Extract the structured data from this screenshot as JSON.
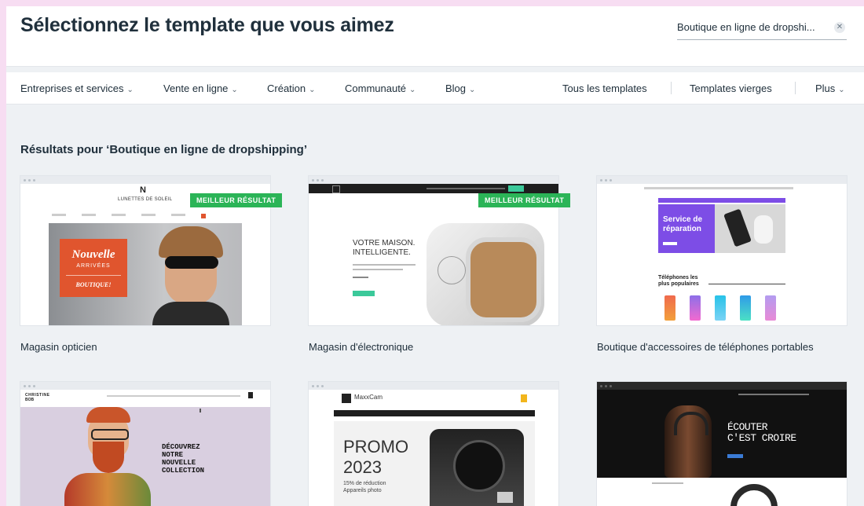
{
  "header": {
    "title": "Sélectionnez le template que vous aimez",
    "search_value": "Boutique en ligne de dropshi...",
    "clear_icon": "close-icon"
  },
  "nav": {
    "items": [
      {
        "label": "Entreprises et services",
        "dropdown": true
      },
      {
        "label": "Vente en ligne",
        "dropdown": true
      },
      {
        "label": "Création",
        "dropdown": true
      },
      {
        "label": "Communauté",
        "dropdown": true
      },
      {
        "label": "Blog",
        "dropdown": true
      }
    ],
    "right": [
      {
        "label": "Tous les templates"
      },
      {
        "label": "Templates vierges"
      },
      {
        "label": "Plus",
        "dropdown": true
      }
    ]
  },
  "results": {
    "heading": "Résultats pour ‘Boutique en ligne de dropshipping’",
    "badge_label": "MEILLEUR RÉSULTAT",
    "templates": [
      {
        "name": "Magasin opticien",
        "best": true,
        "preview": {
          "logo": "N",
          "brand": "LUNETTES DE SOLEIL",
          "promo_line1": "Nouvelle",
          "promo_line2": "ARRIVÉES",
          "promo_button": "BOUTIQUE!",
          "accent": "#e0552e"
        }
      },
      {
        "name": "Magasin d'électronique",
        "best": true,
        "preview": {
          "headline_line1": "VOTRE MAISON.",
          "headline_line2": "INTELLIGENTE.",
          "accent": "#3bc99a"
        }
      },
      {
        "name": "Boutique d'accessoires de téléphones portables",
        "best": false,
        "preview": {
          "banner_line1": "Service de",
          "banner_line2": "réparation",
          "section_line1": "Téléphones les",
          "section_line2": "plus populaires",
          "accent": "#7d4de6"
        }
      },
      {
        "name": "",
        "best": false,
        "preview": {
          "brand_line1": "CHRISTINE",
          "brand_line2": "BOB",
          "promo_line1": "DÉCOUVREZ",
          "promo_line2": "NOTRE",
          "promo_line3": "NOUVELLE",
          "promo_line4": "COLLECTION",
          "bg": "#d9cfe0"
        }
      },
      {
        "name": "",
        "best": false,
        "preview": {
          "brand": "MaxxCam",
          "promo_line1": "PROMO",
          "promo_line2": "2023",
          "sub_line1": "15% de réduction",
          "sub_line2": "Appareils photo",
          "accent": "#f2b51c"
        }
      },
      {
        "name": "",
        "best": false,
        "preview": {
          "headline_line1": "ÉCOUTER",
          "headline_line2": "C'EST CROIRE",
          "bg": "#111111"
        }
      }
    ]
  }
}
